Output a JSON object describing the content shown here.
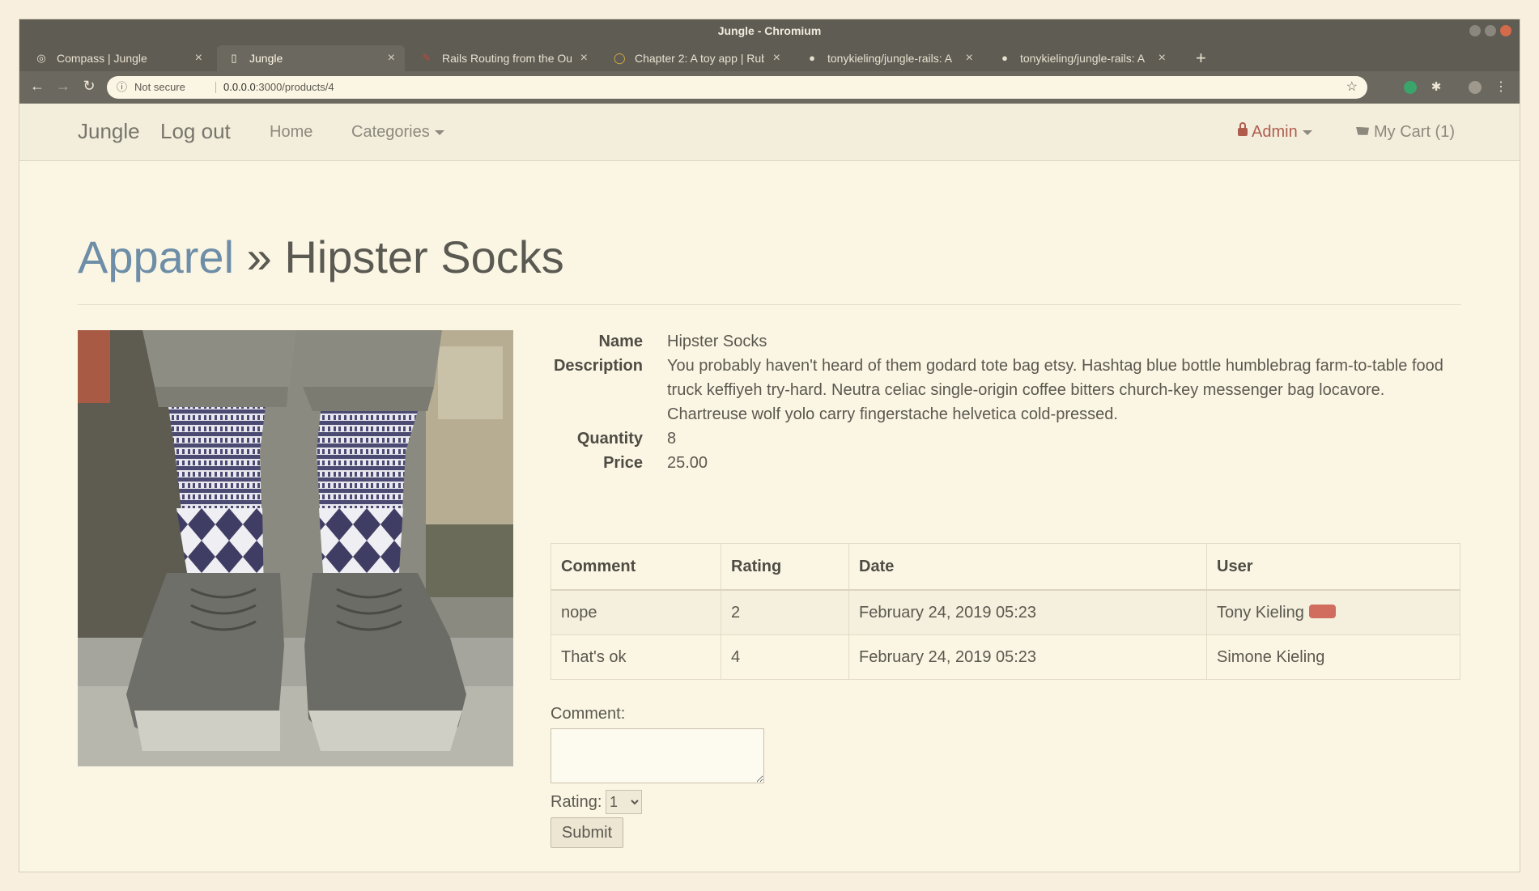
{
  "window": {
    "title": "Jungle - Chromium"
  },
  "tabs": [
    {
      "label": "Compass | Jungle",
      "icon": "compass-icon",
      "active": false
    },
    {
      "label": "Jungle",
      "icon": "page-icon",
      "active": true
    },
    {
      "label": "Rails Routing from the Ou",
      "icon": "rails-icon",
      "active": false
    },
    {
      "label": "Chapter 2: A toy app | Rub",
      "icon": "book-icon",
      "active": false
    },
    {
      "label": "tonykieling/jungle-rails: A",
      "icon": "github-icon",
      "active": false
    },
    {
      "label": "tonykieling/jungle-rails: A",
      "icon": "github-icon",
      "active": false
    }
  ],
  "addressbar": {
    "security_label": "Not secure",
    "url_host": "0.0.0.0",
    "url_path": ":3000/products/4"
  },
  "navbar": {
    "brand": "Jungle",
    "logout": "Log out",
    "home": "Home",
    "categories": "Categories",
    "admin": "Admin",
    "cart": "My Cart (1)"
  },
  "product": {
    "category": "Apparel",
    "separator": "»",
    "title": "Hipster Socks",
    "labels": {
      "name": "Name",
      "description": "Description",
      "quantity": "Quantity",
      "price": "Price"
    },
    "name": "Hipster Socks",
    "description": "You probably haven't heard of them godard tote bag etsy. Hashtag blue bottle humblebrag farm-to-table food truck keffiyeh try-hard. Neutra celiac single-origin coffee bitters church-key messenger bag locavore. Chartreuse wolf yolo carry fingerstache helvetica cold-pressed.",
    "quantity": "8",
    "price": "25.00"
  },
  "reviews": {
    "headers": [
      "Comment",
      "Rating",
      "Date",
      "User"
    ],
    "rows": [
      {
        "comment": "nope",
        "rating": "2",
        "date": "February 24, 2019 05:23",
        "user": "Tony Kieling",
        "deletable": true
      },
      {
        "comment": "That's ok",
        "rating": "4",
        "date": "February 24, 2019 05:23",
        "user": "Simone Kieling",
        "deletable": false
      }
    ]
  },
  "form": {
    "comment_label": "Comment:",
    "comment_value": "",
    "rating_label": "Rating:",
    "rating_value": "1",
    "submit_label": "Submit"
  },
  "colors": {
    "link": "#6e8ea8",
    "admin": "#b05c4d",
    "delete": "#d16d5f",
    "page_bg": "#fbf6e4"
  }
}
